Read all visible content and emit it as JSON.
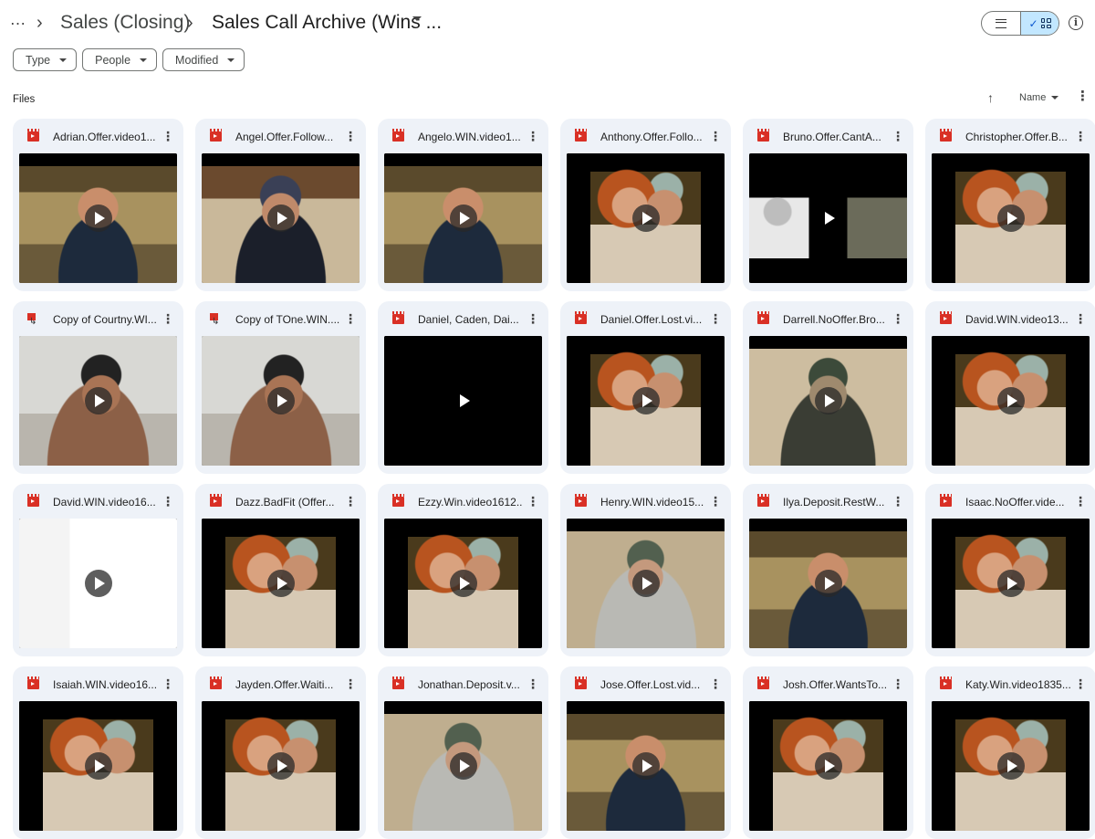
{
  "header": {
    "more": "…",
    "crumbs": [
      "Sales (Closing)",
      "Sales Call Archive (Wins ..."
    ],
    "info": "i"
  },
  "filters": [
    "Type",
    "People",
    "Modified"
  ],
  "section_label": "Files",
  "sort": {
    "label": "Name"
  },
  "files": [
    {
      "name": "Adrian.Offer.video1...",
      "scene": "man-headphones-warm",
      "shortcut": false
    },
    {
      "name": "Angel.Offer.Follow...",
      "scene": "man-cap-dark",
      "shortcut": false
    },
    {
      "name": "Angelo.WIN.video1...",
      "scene": "man-headphones-warm",
      "shortcut": false
    },
    {
      "name": "Anthony.Offer.Follo...",
      "scene": "couple-forest",
      "shortcut": false
    },
    {
      "name": "Bruno.Offer.CantA...",
      "scene": "split-call",
      "shortcut": false
    },
    {
      "name": "Christopher.Offer.B...",
      "scene": "couple-forest",
      "shortcut": false
    },
    {
      "name": "Copy of Courtny.WI...",
      "scene": "man-gym",
      "shortcut": true
    },
    {
      "name": "Copy of TOne.WIN....",
      "scene": "man-gym",
      "shortcut": true
    },
    {
      "name": "Daniel, Caden, Dai...",
      "scene": "black",
      "shortcut": false
    },
    {
      "name": "Daniel.Offer.Lost.vi...",
      "scene": "couple-forest",
      "shortcut": false
    },
    {
      "name": "Darrell.NoOffer.Bro...",
      "scene": "man-headphones-cool",
      "shortcut": false
    },
    {
      "name": "David.WIN.video13...",
      "scene": "couple-forest",
      "shortcut": false
    },
    {
      "name": "David.WIN.video16...",
      "scene": "screen-share",
      "shortcut": false
    },
    {
      "name": "Dazz.BadFit (Offer...",
      "scene": "couple-forest",
      "shortcut": false
    },
    {
      "name": "Ezzy.Win.video1612...",
      "scene": "couple-forest",
      "shortcut": false
    },
    {
      "name": "Henry.WIN.video15...",
      "scene": "man-hoodie-grey",
      "shortcut": false
    },
    {
      "name": "Ilya.Deposit.RestW...",
      "scene": "man-headphones-warm",
      "shortcut": false
    },
    {
      "name": "Isaac.NoOffer.vide...",
      "scene": "couple-forest",
      "shortcut": false
    },
    {
      "name": "Isaiah.WIN.video16...",
      "scene": "couple-forest",
      "shortcut": false
    },
    {
      "name": "Jayden.Offer.Waiti...",
      "scene": "couple-forest",
      "shortcut": false
    },
    {
      "name": "Jonathan.Deposit.v...",
      "scene": "man-hoodie-grey",
      "shortcut": false
    },
    {
      "name": "Jose.Offer.Lost.vid...",
      "scene": "man-headphones-warm",
      "shortcut": false
    },
    {
      "name": "Josh.Offer.WantsTo...",
      "scene": "couple-forest",
      "shortcut": false
    },
    {
      "name": "Katy.Win.video1835...",
      "scene": "couple-forest",
      "shortcut": false
    }
  ],
  "colors": {
    "accent": "#0b57d0",
    "card_bg": "#eef2f8",
    "video_icon": "#d93025",
    "toggle_active": "#c2e7ff"
  }
}
